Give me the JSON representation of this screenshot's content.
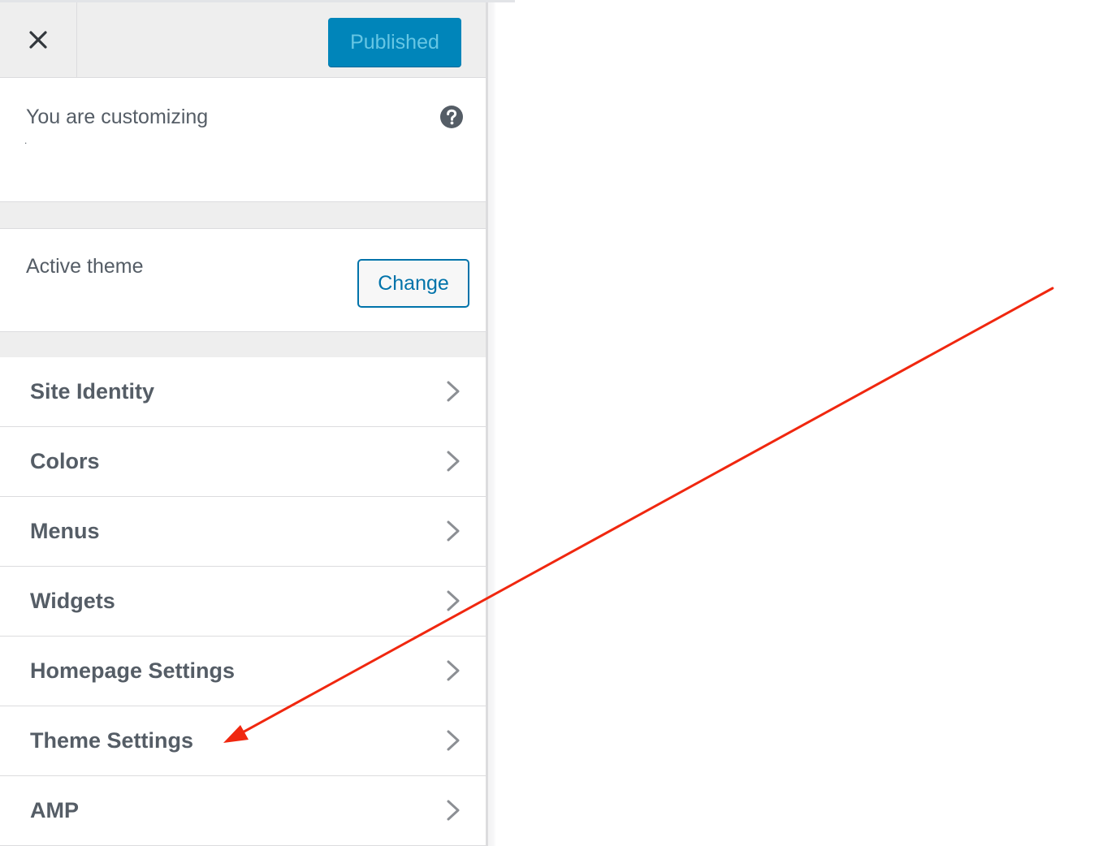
{
  "header": {
    "close_icon": "close-icon",
    "publish_label": "Published"
  },
  "info": {
    "label": "You are customizing",
    "site_name": ".",
    "help_icon": "help-icon"
  },
  "theme": {
    "label": "Active theme",
    "change_label": "Change"
  },
  "sections": [
    {
      "label": "Site Identity"
    },
    {
      "label": "Colors"
    },
    {
      "label": "Menus"
    },
    {
      "label": "Widgets"
    },
    {
      "label": "Homepage Settings"
    },
    {
      "label": "Theme Settings"
    },
    {
      "label": "AMP"
    }
  ],
  "colors": {
    "primary_button": "#0085ba",
    "link": "#0073aa",
    "annotation_arrow": "#f0270f"
  }
}
